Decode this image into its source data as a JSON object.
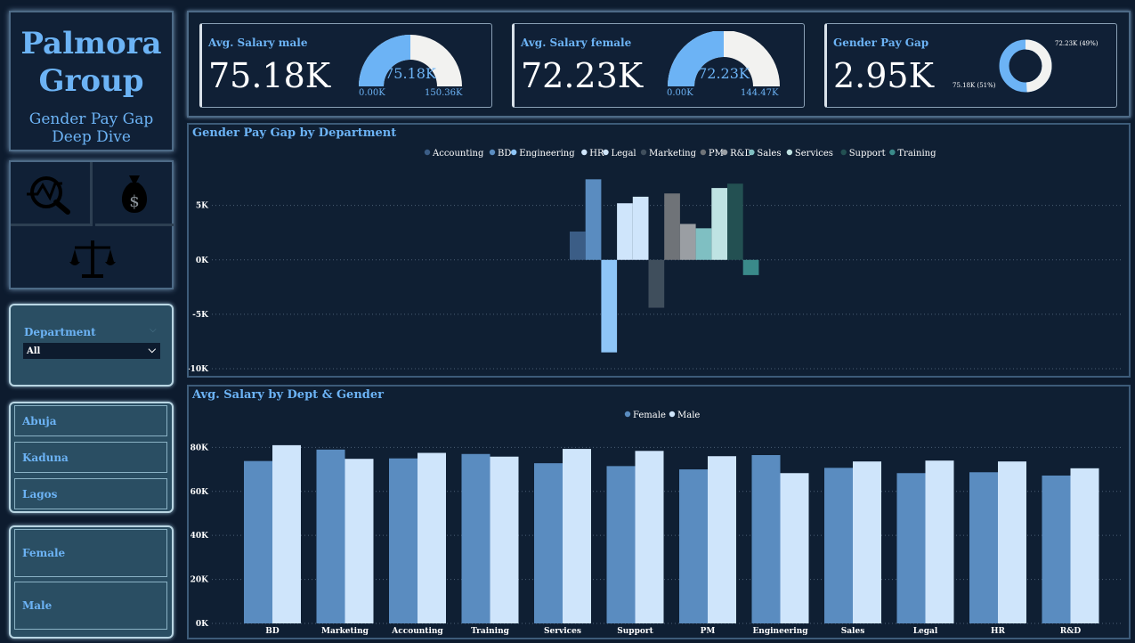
{
  "brand": {
    "title_line1": "Palmora",
    "title_line2": "Group",
    "subtitle": "Gender Pay Gap Deep Dive"
  },
  "nav_icons": [
    "analytics-icon",
    "money-bag-icon",
    "scales-icon"
  ],
  "department_slicer": {
    "label": "Department",
    "selected": "All",
    "chevron_icon": "chevron-down-icon"
  },
  "locations": [
    "Abuja",
    "Kaduna",
    "Lagos"
  ],
  "genders": [
    "Female",
    "Male"
  ],
  "kpis": {
    "male": {
      "label": "Avg. Salary male",
      "value": "75.18K",
      "gauge_value": "75.18K",
      "gauge_min": "0.00K",
      "gauge_max": "150.36K",
      "fraction": 0.5
    },
    "female": {
      "label": "Avg. Salary female",
      "value": "72.23K",
      "gauge_value": "72.23K",
      "gauge_min": "0.00K",
      "gauge_max": "144.47K",
      "fraction": 0.5
    },
    "gap": {
      "label": "Gender Pay Gap",
      "value": "2.95K",
      "donut_label_right": "72.23K (49%)",
      "donut_label_left": "75.18K (51%)",
      "fraction_female": 0.49
    }
  },
  "colors": {
    "accent": "#6cb3f5",
    "female": "#5a8cc0",
    "male": "#cfe5fb",
    "gauge_fill": "#6cb3f5",
    "gauge_track": "#f2f2f0"
  },
  "chart_data": [
    {
      "type": "bar",
      "title": "Gender Pay Gap by Department",
      "categories": [
        "Accounting",
        "BD",
        "Engineering",
        "HR",
        "Legal",
        "Marketing",
        "PM",
        "R&D",
        "Sales",
        "Services",
        "Support",
        "Training"
      ],
      "values": [
        2600,
        7400,
        -8500,
        5200,
        5800,
        -4400,
        6100,
        3300,
        2900,
        6600,
        7000,
        -1400
      ],
      "series_colors": [
        "#3b5d86",
        "#5a8cc0",
        "#8ec5f7",
        "#cfe5fb",
        "#cfe5fb",
        "#3f4e5c",
        "#6f7378",
        "#9a9ea3",
        "#7fbfc2",
        "#bfe3e3",
        "#235052",
        "#3a8a8a"
      ],
      "yticks": [
        "5K",
        "0K",
        "-5K",
        "-10K"
      ],
      "ytick_values": [
        5000,
        0,
        -5000,
        -10000
      ],
      "ylim": [
        -10000,
        8000
      ],
      "legend": "top-center",
      "grid": true
    },
    {
      "type": "bar",
      "title": "Avg. Salary by Dept & Gender",
      "categories": [
        "BD",
        "Marketing",
        "Accounting",
        "Training",
        "Services",
        "Support",
        "PM",
        "Engineering",
        "Sales",
        "Legal",
        "HR",
        "R&D"
      ],
      "series": [
        {
          "name": "Female",
          "values": [
            73800,
            79000,
            75000,
            77000,
            72800,
            71500,
            70000,
            76500,
            70700,
            68300,
            68700,
            67200
          ]
        },
        {
          "name": "Male",
          "values": [
            81000,
            74800,
            77500,
            75800,
            79300,
            78400,
            76000,
            68300,
            73600,
            74000,
            73600,
            70500
          ]
        }
      ],
      "yticks": [
        "80K",
        "60K",
        "40K",
        "20K",
        "0K"
      ],
      "ytick_values": [
        80000,
        60000,
        40000,
        20000,
        0
      ],
      "ylim": [
        0,
        85000
      ],
      "legend": "top-center",
      "grid": true
    }
  ]
}
